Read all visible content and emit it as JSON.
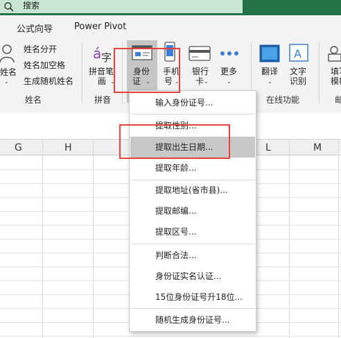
{
  "search": {
    "label": "搜索"
  },
  "tabs": [
    {
      "label": "公式向导"
    },
    {
      "label": "Power Pivot"
    }
  ],
  "name_group": {
    "label": "姓名",
    "big_button": "姓名",
    "commands": [
      "姓名分开",
      "姓名加空格",
      "生成随机姓名"
    ]
  },
  "pinyin_group": {
    "label": "拼音",
    "button_line1": "拼音笔",
    "button_line2": "画"
  },
  "id_group": {
    "id_line1": "身份",
    "id_line2": "证",
    "phone_line1": "手机",
    "phone_line2": "号",
    "bank_line1": "银行",
    "bank_line2": "卡",
    "more": "更多"
  },
  "online_group": {
    "label": "在线功能",
    "translate": "翻译",
    "ocr_line1": "文字",
    "ocr_line2": "识别"
  },
  "fill_partial": {
    "line1": "填写",
    "line2": "模板",
    "label_partial": "邮"
  },
  "columns": [
    "G",
    "H",
    "L",
    "M"
  ],
  "menu": {
    "items": [
      "输入身份证号...",
      "提取性别...",
      "提取出生日期...",
      "提取年龄...",
      "提取地址(省市县)...",
      "提取邮编...",
      "提取区号...",
      "判断合法...",
      "身份证实名认证...",
      "15位身份证号升18位...",
      "随机生成身份证号..."
    ],
    "active_index": 2
  },
  "colors": {
    "title_bar": "#217346",
    "search_box": "#c9e6d2",
    "highlight_red": "#e8413c",
    "menu_active": "#c8c8c8"
  }
}
